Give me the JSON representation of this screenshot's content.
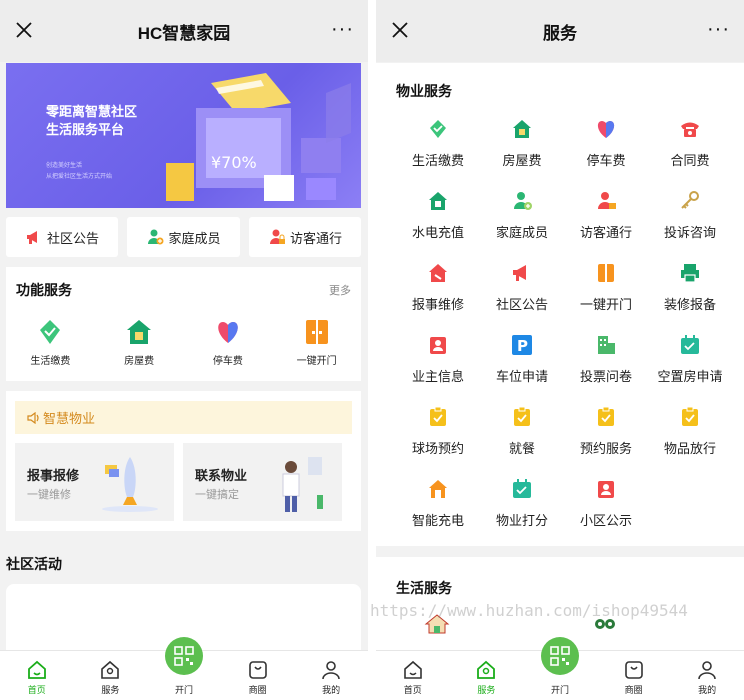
{
  "left": {
    "header": {
      "title": "HC智慧家园",
      "more": "···"
    },
    "banner": {
      "line1": "零距离智慧社区",
      "line2": "生活服务平台",
      "sub1": "创造美好生活",
      "sub2": "从把爱社区生活方式开始",
      "price_tag": "¥70%"
    },
    "quick_links": [
      "社区公告",
      "家庭成员",
      "访客通行"
    ],
    "functions": {
      "title": "功能服务",
      "more": "更多",
      "items": [
        "生活缴费",
        "房屋费",
        "停车费",
        "一键开门"
      ]
    },
    "notice": {
      "text": "智慧物业"
    },
    "cards": [
      {
        "title": "报事报修",
        "sub": "一键维修"
      },
      {
        "title": "联系物业",
        "sub": "一键搞定"
      }
    ],
    "activity": {
      "title": "社区活动"
    },
    "tabs": [
      "首页",
      "服务",
      "开门",
      "商圈",
      "我的"
    ]
  },
  "right": {
    "header": {
      "title": "服务",
      "more": "···"
    },
    "property": {
      "title": "物业服务",
      "items": [
        "生活缴费",
        "房屋费",
        "停车费",
        "合同费",
        "水电充值",
        "家庭成员",
        "访客通行",
        "投诉咨询",
        "报事维修",
        "社区公告",
        "一键开门",
        "装修报备",
        "业主信息",
        "车位申请",
        "投票问卷",
        "空置房申请",
        "球场预约",
        "就餐",
        "预约服务",
        "物品放行",
        "智能充电",
        "物业打分",
        "小区公示"
      ]
    },
    "life": {
      "title": "生活服务"
    },
    "tabs": [
      "首页",
      "服务",
      "开门",
      "商圈",
      "我的"
    ]
  },
  "watermark": "https://www.huzhan.com/ishop49544",
  "colors": {
    "accent": "#1aad19",
    "banner": "#7a6ff0",
    "notice": "#d48a1e"
  }
}
